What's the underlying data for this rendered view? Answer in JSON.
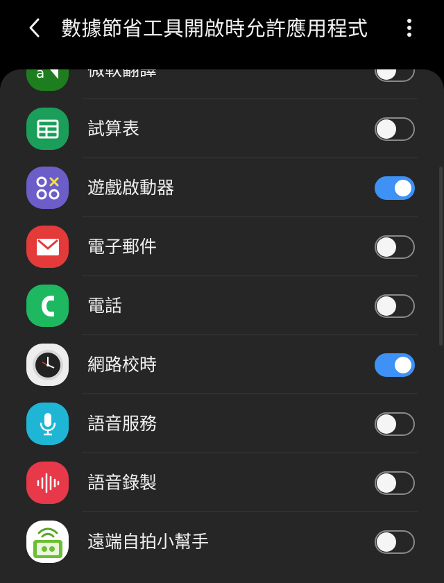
{
  "header": {
    "title": "數據節省工具開啟時允許應用程式",
    "back_icon": "chevron-left-icon",
    "more_icon": "more-vertical-icon"
  },
  "apps": [
    {
      "label": "微軟翻譯",
      "icon": "microsoft-translator-icon",
      "enabled": false
    },
    {
      "label": "試算表",
      "icon": "spreadsheet-icon",
      "enabled": false
    },
    {
      "label": "遊戲啟動器",
      "icon": "game-launcher-icon",
      "enabled": true
    },
    {
      "label": "電子郵件",
      "icon": "email-icon",
      "enabled": false
    },
    {
      "label": "電話",
      "icon": "phone-icon",
      "enabled": false
    },
    {
      "label": "網路校時",
      "icon": "clock-icon",
      "enabled": true
    },
    {
      "label": "語音服務",
      "icon": "microphone-icon",
      "enabled": false
    },
    {
      "label": "語音錄製",
      "icon": "voice-recorder-icon",
      "enabled": false
    },
    {
      "label": "遠端自拍小幫手",
      "icon": "remote-selfie-icon",
      "enabled": false
    }
  ],
  "colors": {
    "background": "#000000",
    "card": "#262626",
    "toggle_on": "#3e91f5",
    "toggle_off_border": "#8a8a8a"
  }
}
